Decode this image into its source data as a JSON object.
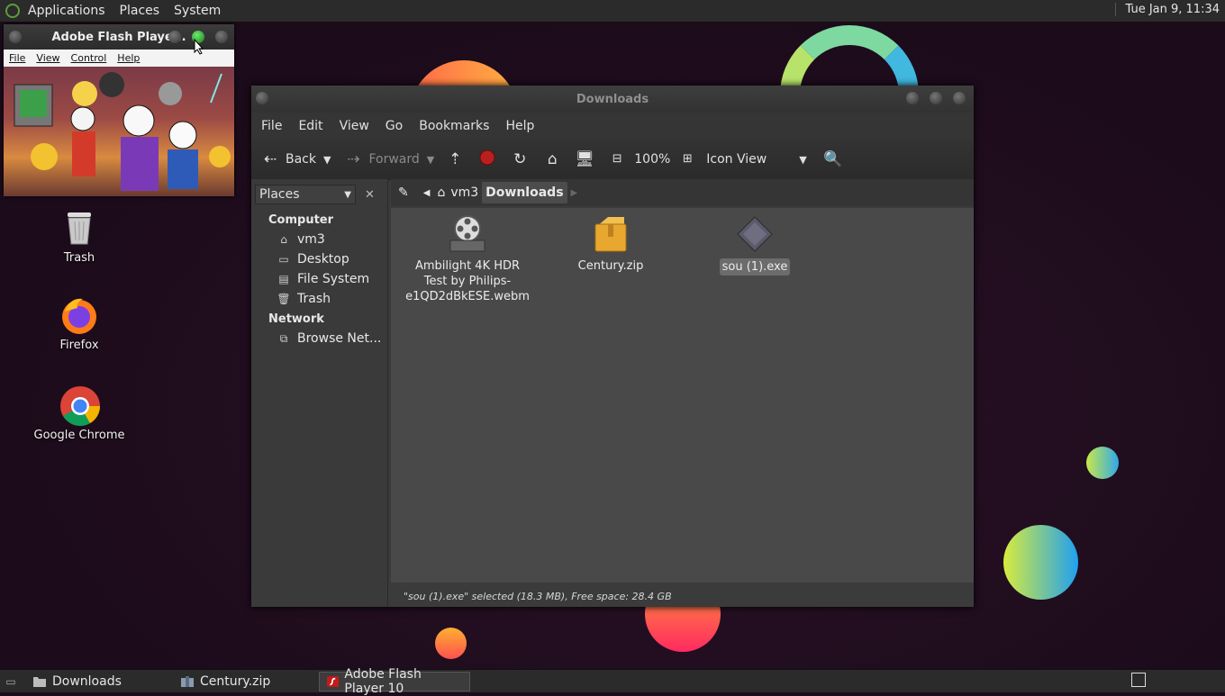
{
  "top_panel": {
    "menus": [
      "Applications",
      "Places",
      "System"
    ],
    "clock": "Tue Jan  9, 11:34"
  },
  "desktop_icons": [
    {
      "label": "Trash",
      "icon": "trash-icon"
    },
    {
      "label": "Firefox",
      "icon": "firefox-icon"
    },
    {
      "label": "Google Chrome",
      "icon": "chrome-icon"
    }
  ],
  "flash_window": {
    "title": "Adobe Flash Playe...",
    "menus": [
      "File",
      "View",
      "Control",
      "Help"
    ]
  },
  "file_manager": {
    "title": "Downloads",
    "menus": [
      "File",
      "Edit",
      "View",
      "Go",
      "Bookmarks",
      "Help"
    ],
    "toolbar": {
      "back": "Back",
      "forward": "Forward",
      "zoom": "100%",
      "view_mode": "Icon View"
    },
    "sidebar": {
      "combo": "Places",
      "sections": [
        {
          "header": "Computer",
          "items": [
            {
              "label": "vm3",
              "icon": "home-folder-icon"
            },
            {
              "label": "Desktop",
              "icon": "desktop-folder-icon"
            },
            {
              "label": "File System",
              "icon": "drive-icon"
            },
            {
              "label": "Trash",
              "icon": "trash-icon"
            }
          ]
        },
        {
          "header": "Network",
          "items": [
            {
              "label": "Browse Net...",
              "icon": "network-icon"
            }
          ]
        }
      ]
    },
    "path": [
      "vm3",
      "Downloads"
    ],
    "files": [
      {
        "name": "Ambilight 4K HDR Test by Philips-e1QD2dBkESE.webm",
        "line1": "Ambilight 4K HDR",
        "line2": "Test by Philips-",
        "line3": "e1QD2dBkESE.webm",
        "icon": "video-file-icon",
        "selected": false
      },
      {
        "name": "Century.zip",
        "icon": "archive-file-icon",
        "selected": false
      },
      {
        "name": "sou (1).exe",
        "icon": "executable-file-icon",
        "selected": true
      }
    ],
    "status": "\"sou (1).exe\" selected (18.3 MB), Free space: 28.4 GB"
  },
  "taskbar": [
    {
      "label": "Downloads",
      "icon": "folder-icon",
      "active": false
    },
    {
      "label": "Century.zip",
      "icon": "archive-manager-icon",
      "active": false
    },
    {
      "label": "Adobe Flash Player 10",
      "icon": "flash-icon",
      "active": true
    }
  ]
}
